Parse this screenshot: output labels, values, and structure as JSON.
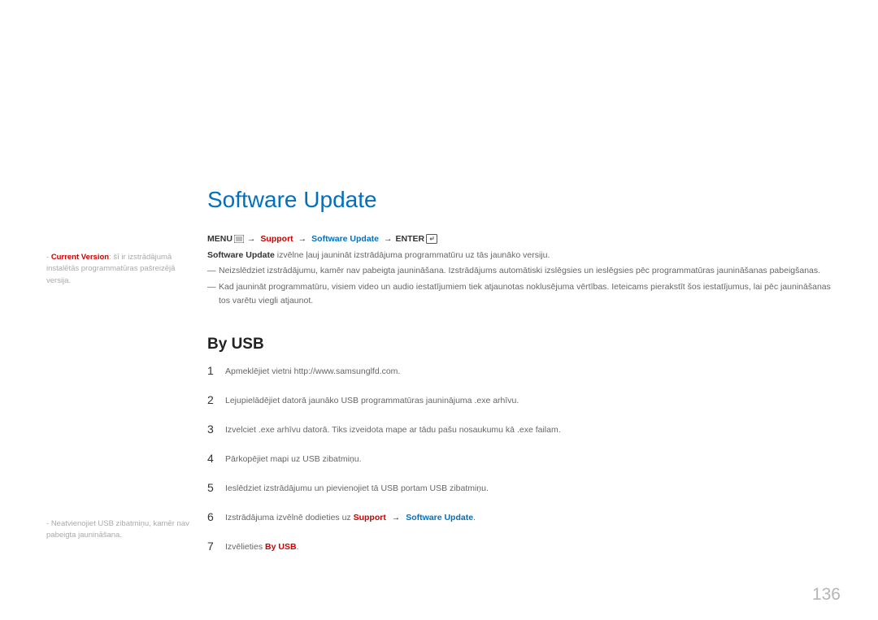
{
  "heading": "Software Update",
  "menu": {
    "menu_label": "MENU",
    "support_label": "Support",
    "sw_label": "Software Update",
    "enter_label": "ENTER"
  },
  "intro": {
    "bold": "Software Update",
    "rest": " izvēlne ļauj jaunināt izstrādājuma programmatūru uz tās jaunāko versiju."
  },
  "notes": [
    "Neizslēdziet izstrādājumu, kamēr nav pabeigta jaunināšana. Izstrādājums automātiski izslēgsies un ieslēgsies pēc programmatūras jaunināšanas pabeigšanas.",
    "Kad jaunināt programmatūru, visiem video un audio iestatījumiem tiek atjaunotas noklusējuma vērtības. Ieteicams pierakstīt šos iestatījumus, lai pēc jaunināšanas tos varētu viegli atjaunot."
  ],
  "subheading": "By USB",
  "steps": [
    {
      "n": "1",
      "text": "Apmeklējiet vietni http://www.samsunglfd.com."
    },
    {
      "n": "2",
      "text": "Lejupielādējiet datorā jaunāko USB programmatūras jauninājuma .exe arhīvu."
    },
    {
      "n": "3",
      "text": "Izvelciet .exe arhīvu datorā. Tiks izveidota mape ar tādu pašu nosaukumu kā .exe failam."
    },
    {
      "n": "4",
      "text": "Pārkopējiet mapi uz USB zibatmiņu."
    },
    {
      "n": "5",
      "text": "Ieslēdziet izstrādājumu un pievienojiet tā USB portam USB zibatmiņu."
    }
  ],
  "step6": {
    "n": "6",
    "prefix": "Izstrādājuma izvēlnē dodieties uz ",
    "support": "Support",
    "swu": "Software Update",
    "dot": "."
  },
  "step7": {
    "n": "7",
    "prefix": "Izvēlieties ",
    "byusb": "By USB",
    "dot": "."
  },
  "side1": {
    "dash": "- ",
    "cv": "Current Version",
    "rest": ": šī ir izstrādājumā instalētās programmatūras pašreizējā versija."
  },
  "side2": {
    "dash": "- ",
    "text": "Neatvienojiet USB zibatmiņu, kamēr nav pabeigta jaunināšana."
  },
  "page_number": "136"
}
